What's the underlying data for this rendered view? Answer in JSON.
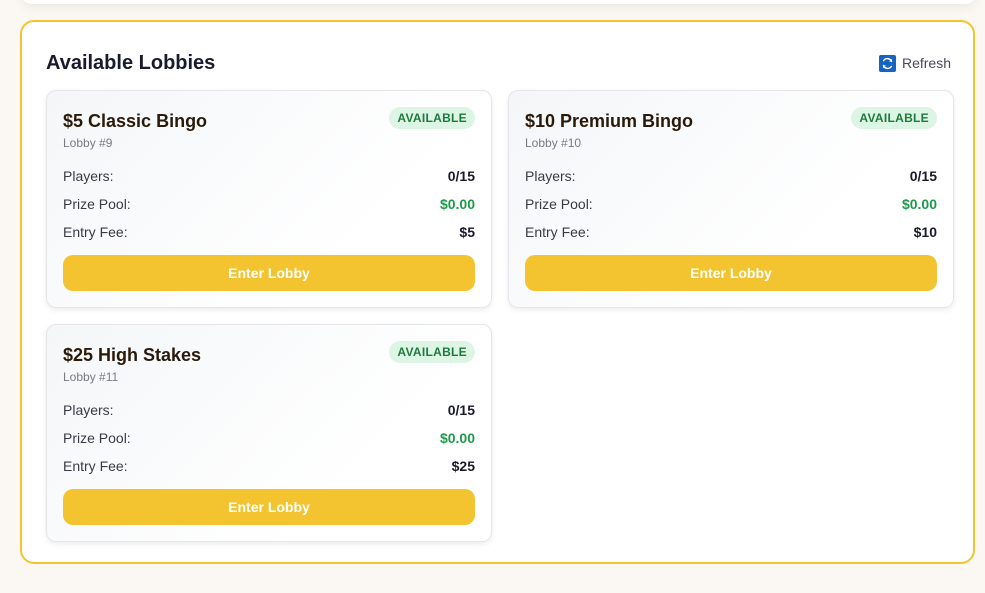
{
  "panel": {
    "title": "Available Lobbies",
    "refresh_label": "Refresh",
    "refresh_icon": "refresh-icon"
  },
  "lobbies": [
    {
      "name": "$5 Classic Bingo",
      "id_label": "Lobby #9",
      "status": "AVAILABLE",
      "players_label": "Players:",
      "players": "0/15",
      "prize_label": "Prize Pool:",
      "prize": "$0.00",
      "fee_label": "Entry Fee:",
      "fee": "$5",
      "button": "Enter Lobby"
    },
    {
      "name": "$10 Premium Bingo",
      "id_label": "Lobby #10",
      "status": "AVAILABLE",
      "players_label": "Players:",
      "players": "0/15",
      "prize_label": "Prize Pool:",
      "prize": "$0.00",
      "fee_label": "Entry Fee:",
      "fee": "$10",
      "button": "Enter Lobby"
    },
    {
      "name": "$25 High Stakes",
      "id_label": "Lobby #11",
      "status": "AVAILABLE",
      "players_label": "Players:",
      "players": "0/15",
      "prize_label": "Prize Pool:",
      "prize": "$0.00",
      "fee_label": "Entry Fee:",
      "fee": "$25",
      "button": "Enter Lobby"
    }
  ],
  "colors": {
    "accent": "#f4c430",
    "badge_bg": "#dcf5e4",
    "badge_text": "#1e7a3c",
    "prize_green": "#1e9a4a",
    "refresh_icon_bg": "#1565c0"
  }
}
